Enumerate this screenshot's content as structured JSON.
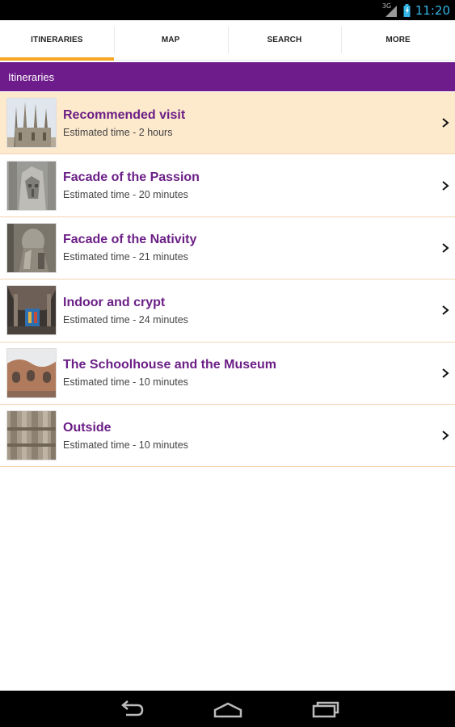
{
  "status_bar": {
    "time": "11:20",
    "signal_tag": "3G",
    "icons": [
      "signal-icon",
      "battery-icon"
    ],
    "accent_color": "#33b5e5"
  },
  "tabs": [
    {
      "label": "ITINERARIES",
      "active": true
    },
    {
      "label": "MAP",
      "active": false
    },
    {
      "label": "SEARCH",
      "active": false
    },
    {
      "label": "MORE",
      "active": false
    }
  ],
  "section_header": {
    "title": "Itineraries",
    "color": "#6e1c8b"
  },
  "itineraries": [
    {
      "title": "Recommended visit",
      "subtitle": "Estimated time - 2 hours",
      "selected": true,
      "thumb": "spires"
    },
    {
      "title": "Facade of the Passion",
      "subtitle": "Estimated time - 20 minutes",
      "selected": false,
      "thumb": "passion"
    },
    {
      "title": "Facade of the Nativity",
      "subtitle": "Estimated time - 21 minutes",
      "selected": false,
      "thumb": "nativity"
    },
    {
      "title": "Indoor and crypt",
      "subtitle": "Estimated time - 24 minutes",
      "selected": false,
      "thumb": "indoor"
    },
    {
      "title": "The Schoolhouse and the Museum",
      "subtitle": "Estimated time - 10 minutes",
      "selected": false,
      "thumb": "school"
    },
    {
      "title": "Outside",
      "subtitle": "Estimated time - 10 minutes",
      "selected": false,
      "thumb": "outside"
    }
  ],
  "nav_bar": {
    "buttons": [
      "back-icon",
      "home-icon",
      "recent-apps-icon"
    ]
  }
}
